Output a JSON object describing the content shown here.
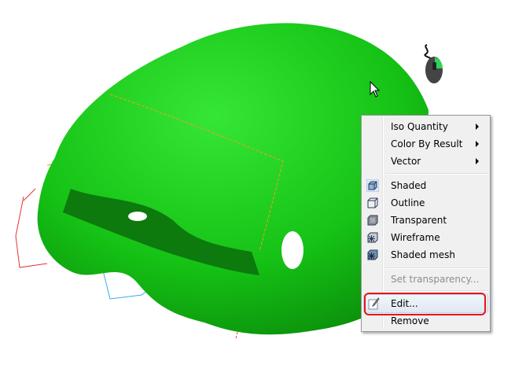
{
  "context_menu": {
    "items": [
      {
        "label": "Iso Quantity",
        "submenu": true
      },
      {
        "label": "Color By Result",
        "submenu": true
      },
      {
        "label": "Vector",
        "submenu": true
      },
      {
        "label": "Shaded",
        "icon": "shaded-cube-icon",
        "checked": true
      },
      {
        "label": "Outline",
        "icon": "outline-cube-icon"
      },
      {
        "label": "Transparent",
        "icon": "transparent-cube-icon"
      },
      {
        "label": "Wireframe",
        "icon": "wireframe-cube-icon"
      },
      {
        "label": "Shaded mesh",
        "icon": "shaded-mesh-cube-icon"
      },
      {
        "label": "Set transparency...",
        "disabled": true
      },
      {
        "label": "Edit...",
        "icon": "edit-pencil-icon",
        "highlighted": true
      },
      {
        "label": "Remove"
      }
    ]
  },
  "colors": {
    "model": "#1ed41e",
    "highlight_box": "#e8141a",
    "mouse_button": "#2ed45a"
  }
}
